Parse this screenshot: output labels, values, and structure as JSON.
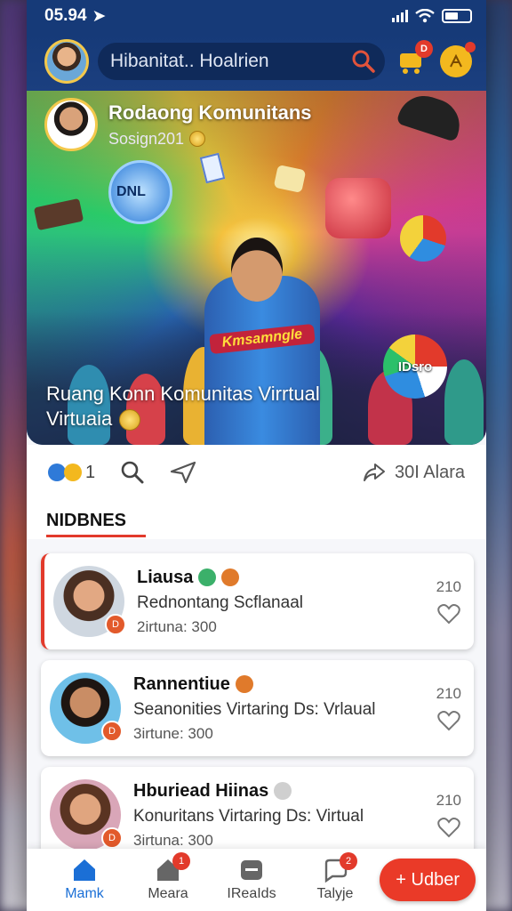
{
  "status_bar": {
    "time": "05.94"
  },
  "top_bar": {
    "search_text": "Hibanitat.. Hoalrien",
    "notification_badge": "D"
  },
  "hero": {
    "title": "Rodaong Komunitans",
    "subtitle": "Sosign201",
    "jersey_text": "Kmsamngle",
    "ball_label": "IDsro",
    "sign_text": "DNL",
    "caption_line1": "Ruang Konn Komunitas Virrtual",
    "caption_line2": "Virtuaia"
  },
  "actions": {
    "reaction_count": "1",
    "share_label": "30I Alara"
  },
  "section": {
    "title": "NIDBNES"
  },
  "cards": [
    {
      "name": "Liausa",
      "desc": "Rednontang Scflanaal",
      "meta": "2irtuna: 300",
      "count": "210",
      "badge": "D"
    },
    {
      "name": "Rannentiue",
      "desc": "Seanonities Virtaring Ds: Vrlaual",
      "meta": "3irtune: 300",
      "count": "210",
      "badge": "D"
    },
    {
      "name": "Hburiead Hiinas",
      "desc": "Konuritans Virtaring Ds: Virtual",
      "meta": "3irtuna: 300",
      "count": "210",
      "badge": "D"
    }
  ],
  "bottom_nav": {
    "items": [
      {
        "label": "Mamk"
      },
      {
        "label": "Meara",
        "badge": "1"
      },
      {
        "label": "IReaIds"
      },
      {
        "label": "Talyje",
        "badge": "2"
      }
    ],
    "add_label": "+ Udber"
  },
  "colors": {
    "brand_blue": "#163a78",
    "accent_red": "#ea3a28",
    "active_nav": "#1b6fd6"
  }
}
